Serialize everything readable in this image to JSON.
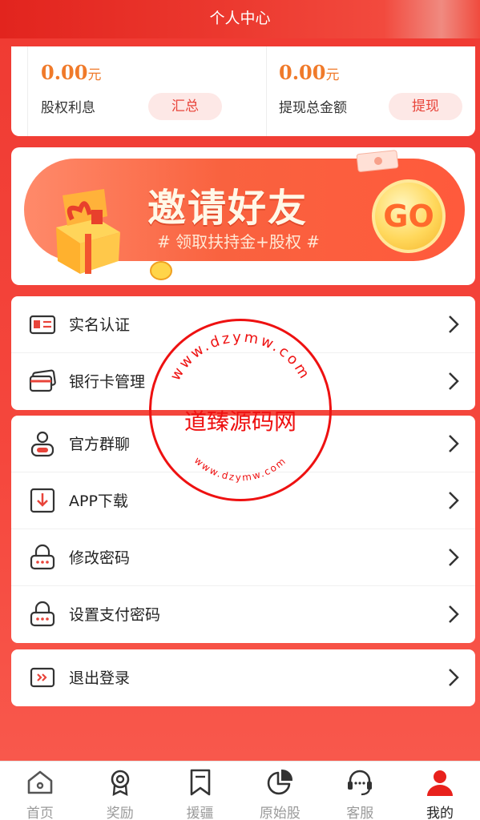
{
  "header": {
    "title": "个人中心"
  },
  "balance": {
    "left": {
      "amount": "0.00",
      "unit": "元",
      "label": "股权利息",
      "button": "汇总"
    },
    "right": {
      "amount": "0.00",
      "unit": "元",
      "label": "提现总金额",
      "button": "提现"
    }
  },
  "banner": {
    "title": "邀请好友",
    "subtitle": "# 领取扶持金+股权 #",
    "go": "GO"
  },
  "menu_group1": [
    {
      "label": "实名认证",
      "icon": "id-card-icon"
    },
    {
      "label": "银行卡管理",
      "icon": "bank-card-icon"
    }
  ],
  "menu_group2": [
    {
      "label": "官方群聊",
      "icon": "user-chat-icon"
    },
    {
      "label": "APP下载",
      "icon": "download-icon"
    },
    {
      "label": "修改密码",
      "icon": "lock-icon"
    },
    {
      "label": "设置支付密码",
      "icon": "lock-icon"
    }
  ],
  "menu_group3": [
    {
      "label": "退出登录",
      "icon": "logout-icon"
    }
  ],
  "tabs": [
    {
      "label": "首页",
      "icon": "home-icon"
    },
    {
      "label": "奖励",
      "icon": "award-icon"
    },
    {
      "label": "援疆",
      "icon": "bookmark-icon"
    },
    {
      "label": "原始股",
      "icon": "pie-chart-icon"
    },
    {
      "label": "客服",
      "icon": "headset-icon"
    },
    {
      "label": "我的",
      "icon": "user-icon",
      "active": true
    }
  ],
  "watermark": {
    "center": "道臻源码网",
    "ring_top": "www.dzymw.com",
    "ring_bottom": "www.dzymw.com"
  },
  "colors": {
    "brand_red": "#ef3a32",
    "amount_orange": "#f07a2a",
    "pill_bg": "#fde8e6"
  }
}
